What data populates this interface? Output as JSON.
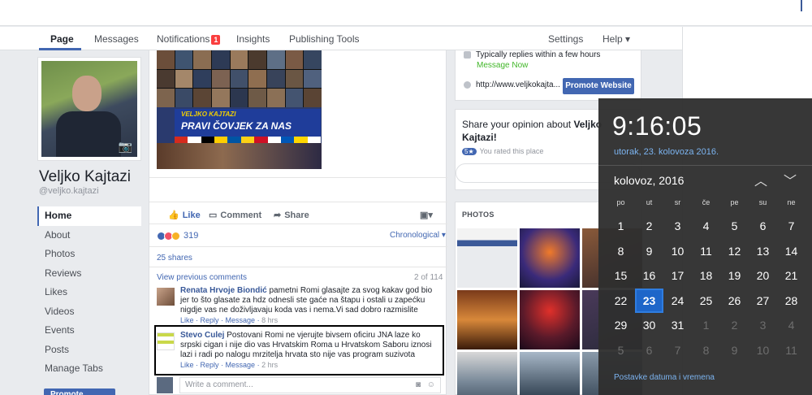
{
  "nav": {
    "page": "Page",
    "messages": "Messages",
    "notifications": "Notifications",
    "notifications_count": "1",
    "insights": "Insights",
    "publishing_tools": "Publishing Tools",
    "settings": "Settings",
    "help": "Help ▾"
  },
  "profile": {
    "name": "Veljko Kajtazi",
    "handle": "@veljko.kajtazi"
  },
  "left_nav": {
    "items": [
      "Home",
      "About",
      "Photos",
      "Reviews",
      "Likes",
      "Videos",
      "Events",
      "Posts",
      "Manage Tabs"
    ],
    "promote": "Promote"
  },
  "post": {
    "image_title_small": "VELJKO KAJTAZI",
    "image_title_big": "PRAVI ČOVJEK ZA NAS",
    "like": "Like",
    "comment": "Comment",
    "share": "Share",
    "reaction_count": "319",
    "chronological": "Chronological ▾",
    "shares": "25 shares",
    "view_previous": "View previous comments",
    "comment_count": "2 of 114",
    "comments": [
      {
        "author": "Renata Hrvoje Biondić",
        "text": "pametni Romi glasajte za svog kakav god bio jer to što glasate za hdz odnesli ste gaće na štapu i ostali u zapećku nigdje vas ne doživljavaju koda vas i nema.Vi sad dobro razmislite",
        "like": "Like",
        "reply": "Reply",
        "message": "Message",
        "time": "8 hrs"
      },
      {
        "author": "Stevo Culej",
        "text": "Postovani Romi ne vjerujte bivsem oficiru JNA laze ko srpski cigan i nije dio vas Hrvatskim Roma u Hrvatskom Saboru iznosi lazi i radi po nalogu mrzitelja hrvata sto nije vas program suzivota",
        "like": "Like",
        "reply": "Reply",
        "message": "Message",
        "time": "2 hrs"
      }
    ],
    "write_placeholder": "Write a comment..."
  },
  "info": {
    "replies": "Typically replies within a few hours",
    "message_now": "Message Now",
    "website": "http://www.veljkokajta...",
    "promote_website": "Promote Website"
  },
  "share_card": {
    "prefix": "Share your opinion about ",
    "name": "Veljko Kajtazi",
    "suffix": "!",
    "rated_badge": "5★",
    "rated": "You rated this place"
  },
  "photos": {
    "header": "PHOTOS"
  },
  "clock": {
    "time": "9:16:05",
    "date": "utorak, 23. kolovoza 2016.",
    "month": "kolovoz, 2016",
    "up": "︿",
    "down": "﹀",
    "weekdays": [
      "po",
      "ut",
      "sr",
      "če",
      "pe",
      "su",
      "ne"
    ],
    "days": [
      "1",
      "2",
      "3",
      "4",
      "5",
      "6",
      "7",
      "8",
      "9",
      "10",
      "11",
      "12",
      "13",
      "14",
      "15",
      "16",
      "17",
      "18",
      "19",
      "20",
      "21",
      "22",
      "23",
      "24",
      "25",
      "26",
      "27",
      "28",
      "29",
      "30",
      "31",
      "1",
      "2",
      "3",
      "4",
      "5",
      "6",
      "7",
      "8",
      "9",
      "10",
      "11"
    ],
    "today_index": 22,
    "other_month_from": 31,
    "settings_link": "Postavke datuma i vremena"
  },
  "colors": {
    "accent": "#4267b2",
    "flyout_bg": "#2f2f2f",
    "today": "#1e66c9",
    "link_blue": "#7cb4f0"
  }
}
